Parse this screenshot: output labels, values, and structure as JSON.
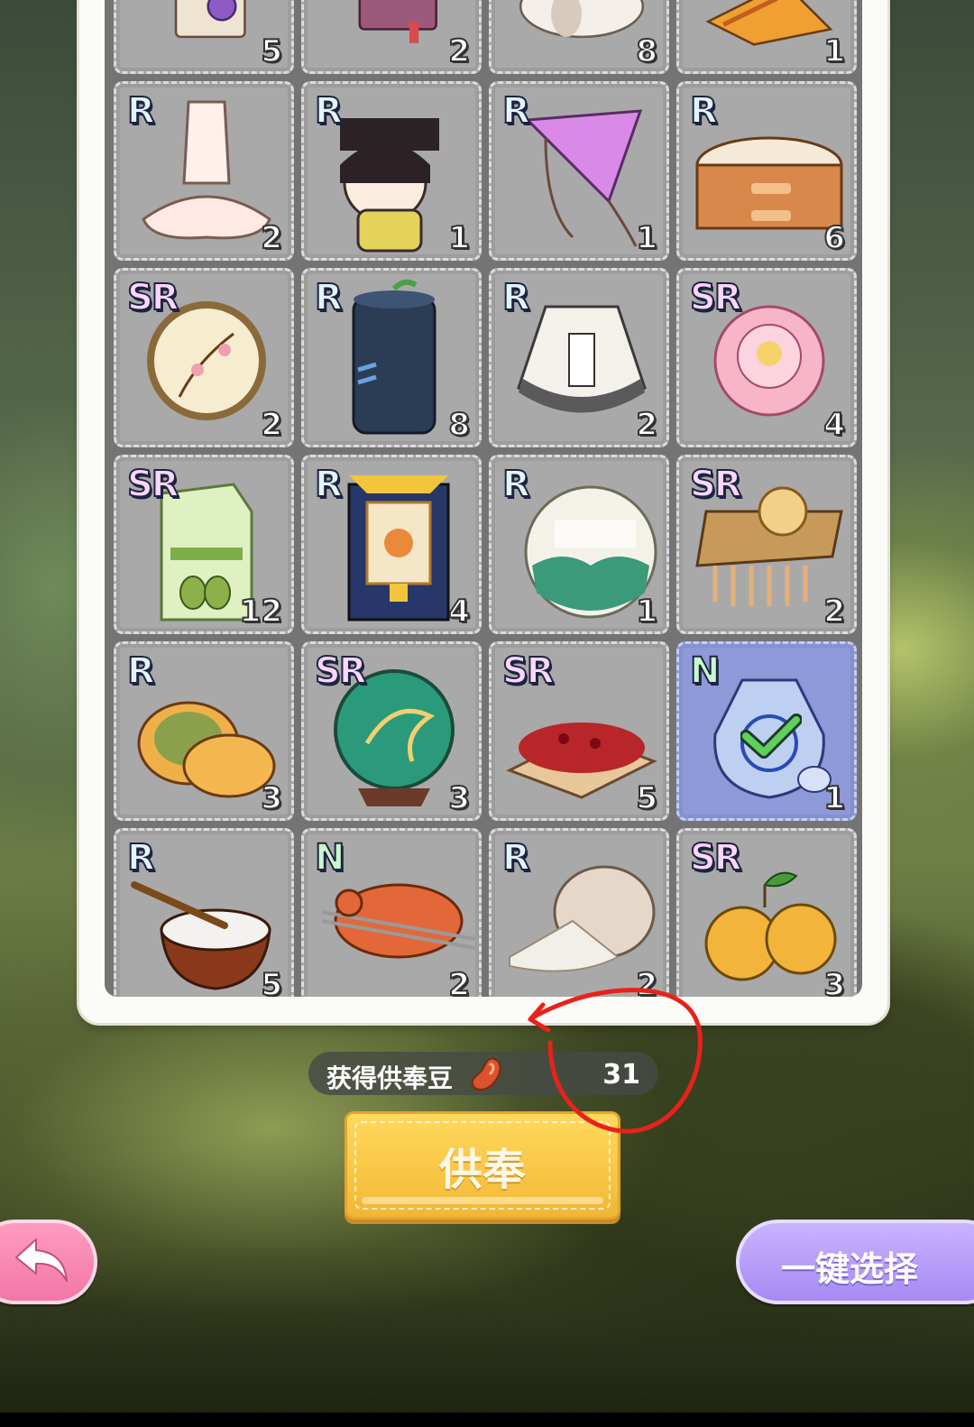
{
  "inventory": {
    "items": [
      {
        "rarity": "",
        "count": "5",
        "icon": "book-scroll-icon",
        "partial": true
      },
      {
        "rarity": "",
        "count": "2",
        "icon": "red-book-icon",
        "partial": true
      },
      {
        "rarity": "",
        "count": "8",
        "icon": "bread-icon",
        "partial": true
      },
      {
        "rarity": "",
        "count": "1",
        "icon": "fan-icon",
        "partial": true
      },
      {
        "rarity": "R",
        "count": "2",
        "icon": "ballet-dress-icon"
      },
      {
        "rarity": "R",
        "count": "1",
        "icon": "qing-doll-icon"
      },
      {
        "rarity": "R",
        "count": "1",
        "icon": "kite-icon"
      },
      {
        "rarity": "R",
        "count": "6",
        "icon": "dumpling-steamer-icon"
      },
      {
        "rarity": "SR",
        "count": "2",
        "icon": "embroidered-fan-icon"
      },
      {
        "rarity": "R",
        "count": "8",
        "icon": "tea-canister-icon"
      },
      {
        "rarity": "R",
        "count": "2",
        "icon": "liquor-jar-icon"
      },
      {
        "rarity": "SR",
        "count": "4",
        "icon": "peony-icon"
      },
      {
        "rarity": "SR",
        "count": "12",
        "icon": "dried-grape-bag-icon"
      },
      {
        "rarity": "R",
        "count": "4",
        "icon": "thangka-icon"
      },
      {
        "rarity": "R",
        "count": "1",
        "icon": "puer-tea-cake-icon"
      },
      {
        "rarity": "SR",
        "count": "2",
        "icon": "flower-headdress-icon"
      },
      {
        "rarity": "R",
        "count": "3",
        "icon": "mooncake-icon"
      },
      {
        "rarity": "SR",
        "count": "3",
        "icon": "jade-phoenix-plate-icon"
      },
      {
        "rarity": "SR",
        "count": "5",
        "icon": "red-dates-icon"
      },
      {
        "rarity": "N",
        "count": "1",
        "icon": "blue-white-vase-icon",
        "selected": true
      },
      {
        "rarity": "R",
        "count": "5",
        "icon": "rice-bowl-icon"
      },
      {
        "rarity": "N",
        "count": "2",
        "icon": "roast-duck-icon"
      },
      {
        "rarity": "R",
        "count": "2",
        "icon": "flour-sack-icon"
      },
      {
        "rarity": "SR",
        "count": "3",
        "icon": "oranges-icon"
      }
    ]
  },
  "reward": {
    "label": "获得供奉豆",
    "icon": "bean-icon",
    "value": "31"
  },
  "buttons": {
    "offer_label": "供奉",
    "back_icon": "back-arrow-icon",
    "auto_select_label": "一键选择"
  },
  "colors": {
    "offer_button": "#f8c545",
    "auto_button": "#a68af2",
    "back_button": "#f276a6",
    "selected_cell": "#8e9ad8",
    "annotation_circle": "#e8221b"
  }
}
